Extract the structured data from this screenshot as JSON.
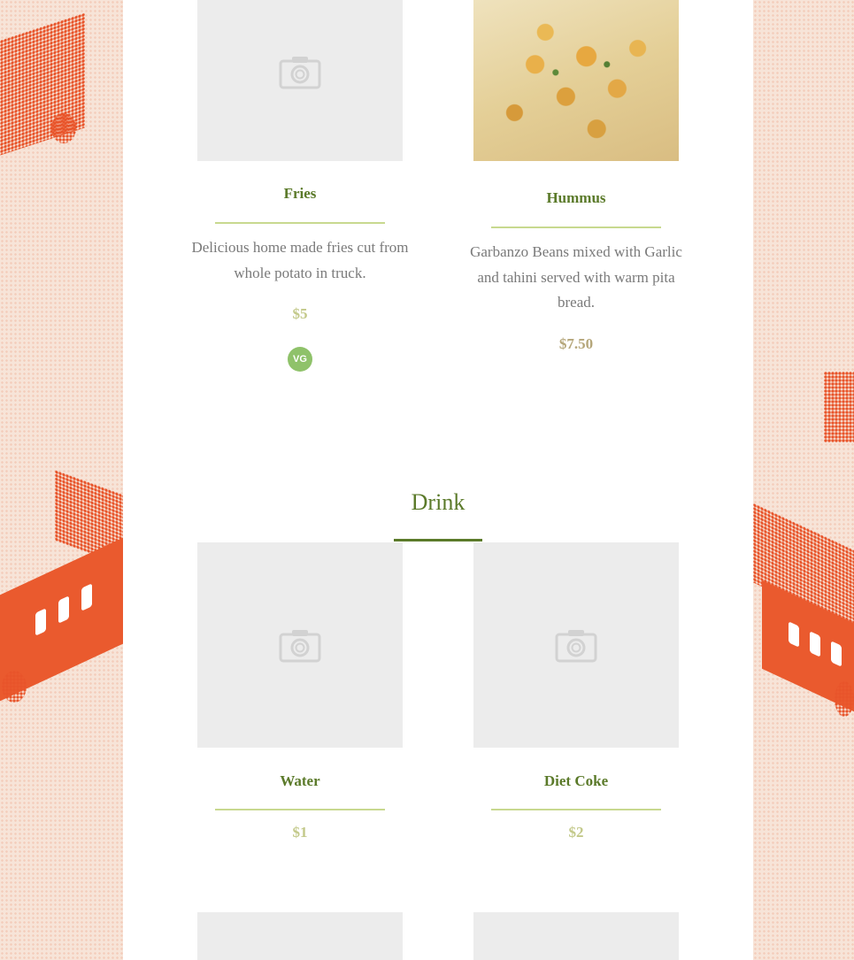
{
  "sections": {
    "drink_title": "Drink"
  },
  "items": {
    "fries": {
      "title": "Fries",
      "description": "Delicious home made fries cut from whole potato in truck.",
      "price": "$5",
      "badge": "VG"
    },
    "hummus": {
      "title": "Hummus",
      "description": "Garbanzo Beans mixed with Garlic and tahini served with warm pita bread.",
      "price": "$7.50"
    },
    "water": {
      "title": "Water",
      "price": "$1"
    },
    "diet_coke": {
      "title": "Diet Coke",
      "price": "$2"
    }
  },
  "colors": {
    "accent": "#5b7a2a",
    "divider": "#c8d98f",
    "badge": "#8fc26a",
    "truck": "#e8542a"
  }
}
